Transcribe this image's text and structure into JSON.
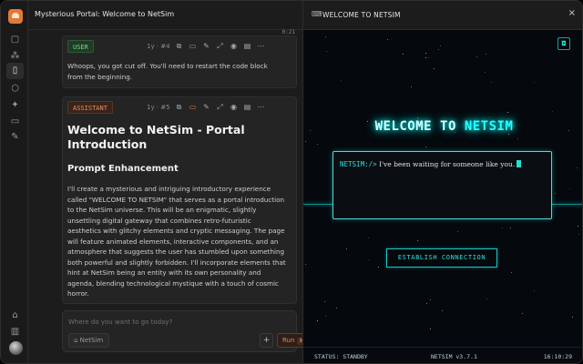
{
  "chat": {
    "title": "Mysterious Portal: Welcome to NetSim",
    "more": "···",
    "elapsed": "0:21"
  },
  "messages": [
    {
      "role": "USER",
      "meta": "1y · #4",
      "text": "Whoops, you got cut off. You'll need to restart the code block from the beginning."
    },
    {
      "role": "ASSISTANT",
      "meta": "1y · #5",
      "heading": "Welcome to NetSim - Portal Introduction",
      "subheading": "Prompt Enhancement",
      "text": "I'll create a mysterious and intriguing introductory experience called \"WELCOME TO NETSIM\" that serves as a portal introduction to the NetSim universe. This will be an enigmatic, slightly unsettling digital gateway that combines retro-futuristic aesthetics with glitchy elements and cryptic messaging. The page will feature animated elements, interactive components, and an atmosphere that suggests the user has stumbled upon something both powerful and slightly forbidden. I'll incorporate elements that hint at NetSim being an entity with its own personality and agenda, blending technological mystique with a touch of cosmic horror."
    }
  ],
  "composer": {
    "placeholder": "Where do you want to go today?",
    "chip_label": "NetSim",
    "plus_label": "+",
    "run_label": "Run",
    "run_shortcut": "⌘⏎"
  },
  "preview": {
    "title": "WELCOME TO NETSIM",
    "welcome_part1": "WELCOME TO ",
    "welcome_part2": "NETSIM",
    "prompt": "NETSIM:/>",
    "terminal_text": "I've been waiting for someone like you.",
    "connect_label": "ESTABLISH CONNECTION",
    "status": "STATUS: STANDBY",
    "version": "NETSIM v3.7.1",
    "clock": "16:10:29"
  },
  "colors": {
    "accent_orange": "#e07a3a",
    "neon_cyan": "#00ffff"
  }
}
